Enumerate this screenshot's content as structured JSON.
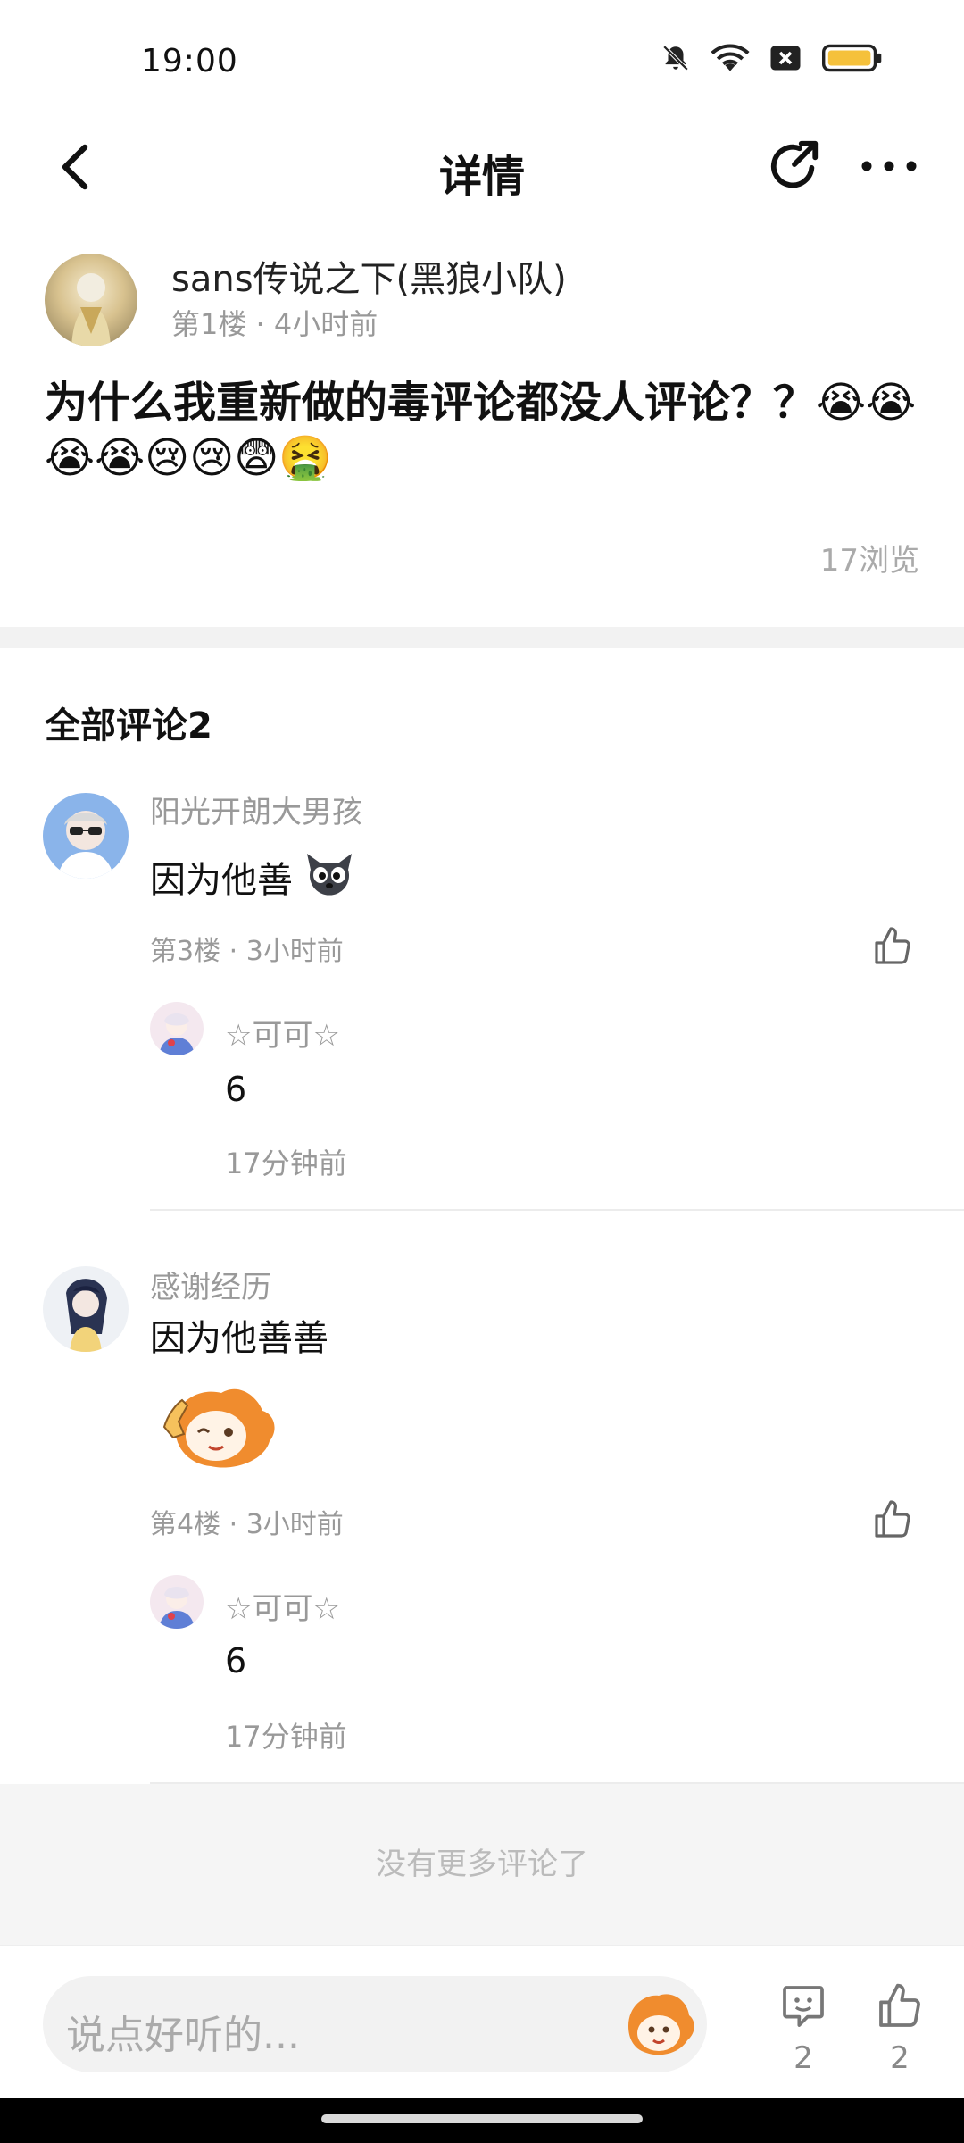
{
  "status_bar": {
    "time": "19:00",
    "icons": [
      "bell-off-icon",
      "wifi-icon",
      "close-box-icon",
      "battery-icon"
    ],
    "battery_color": "#f5c13b"
  },
  "nav": {
    "title": "详情",
    "back_icon": "chevron-left-icon",
    "share_icon": "share-icon",
    "more_icon": "more-icon"
  },
  "post": {
    "author": "sans传说之下(黑狼小队)",
    "meta": "第1楼 · 4小时前",
    "text": "为什么我重新做的毒评论都没人评论？？😭😭😭😭😢😢😨🤮",
    "views": "17浏览"
  },
  "comments": {
    "title": "全部评论2",
    "items": [
      {
        "name": "阳光开朗大男孩",
        "text": "因为他善",
        "sticker": "cat-face-sticker",
        "meta": "第3楼 · 3小时前",
        "reply": {
          "name": "☆可可☆",
          "text": "6",
          "time": "17分钟前"
        }
      },
      {
        "name": "感谢经历",
        "text": "因为他善善",
        "sticker": "orange-mascot-sticker",
        "meta": "第4楼 · 3小时前",
        "reply": {
          "name": "☆可可☆",
          "text": "6",
          "time": "17分钟前"
        }
      }
    ]
  },
  "no_more": "没有更多评论了",
  "bottom_bar": {
    "placeholder": "说点好听的...",
    "comment_count": "2",
    "like_count": "2"
  },
  "colors": {
    "accent_orange": "#f08c2e",
    "text_gray": "#999999"
  }
}
